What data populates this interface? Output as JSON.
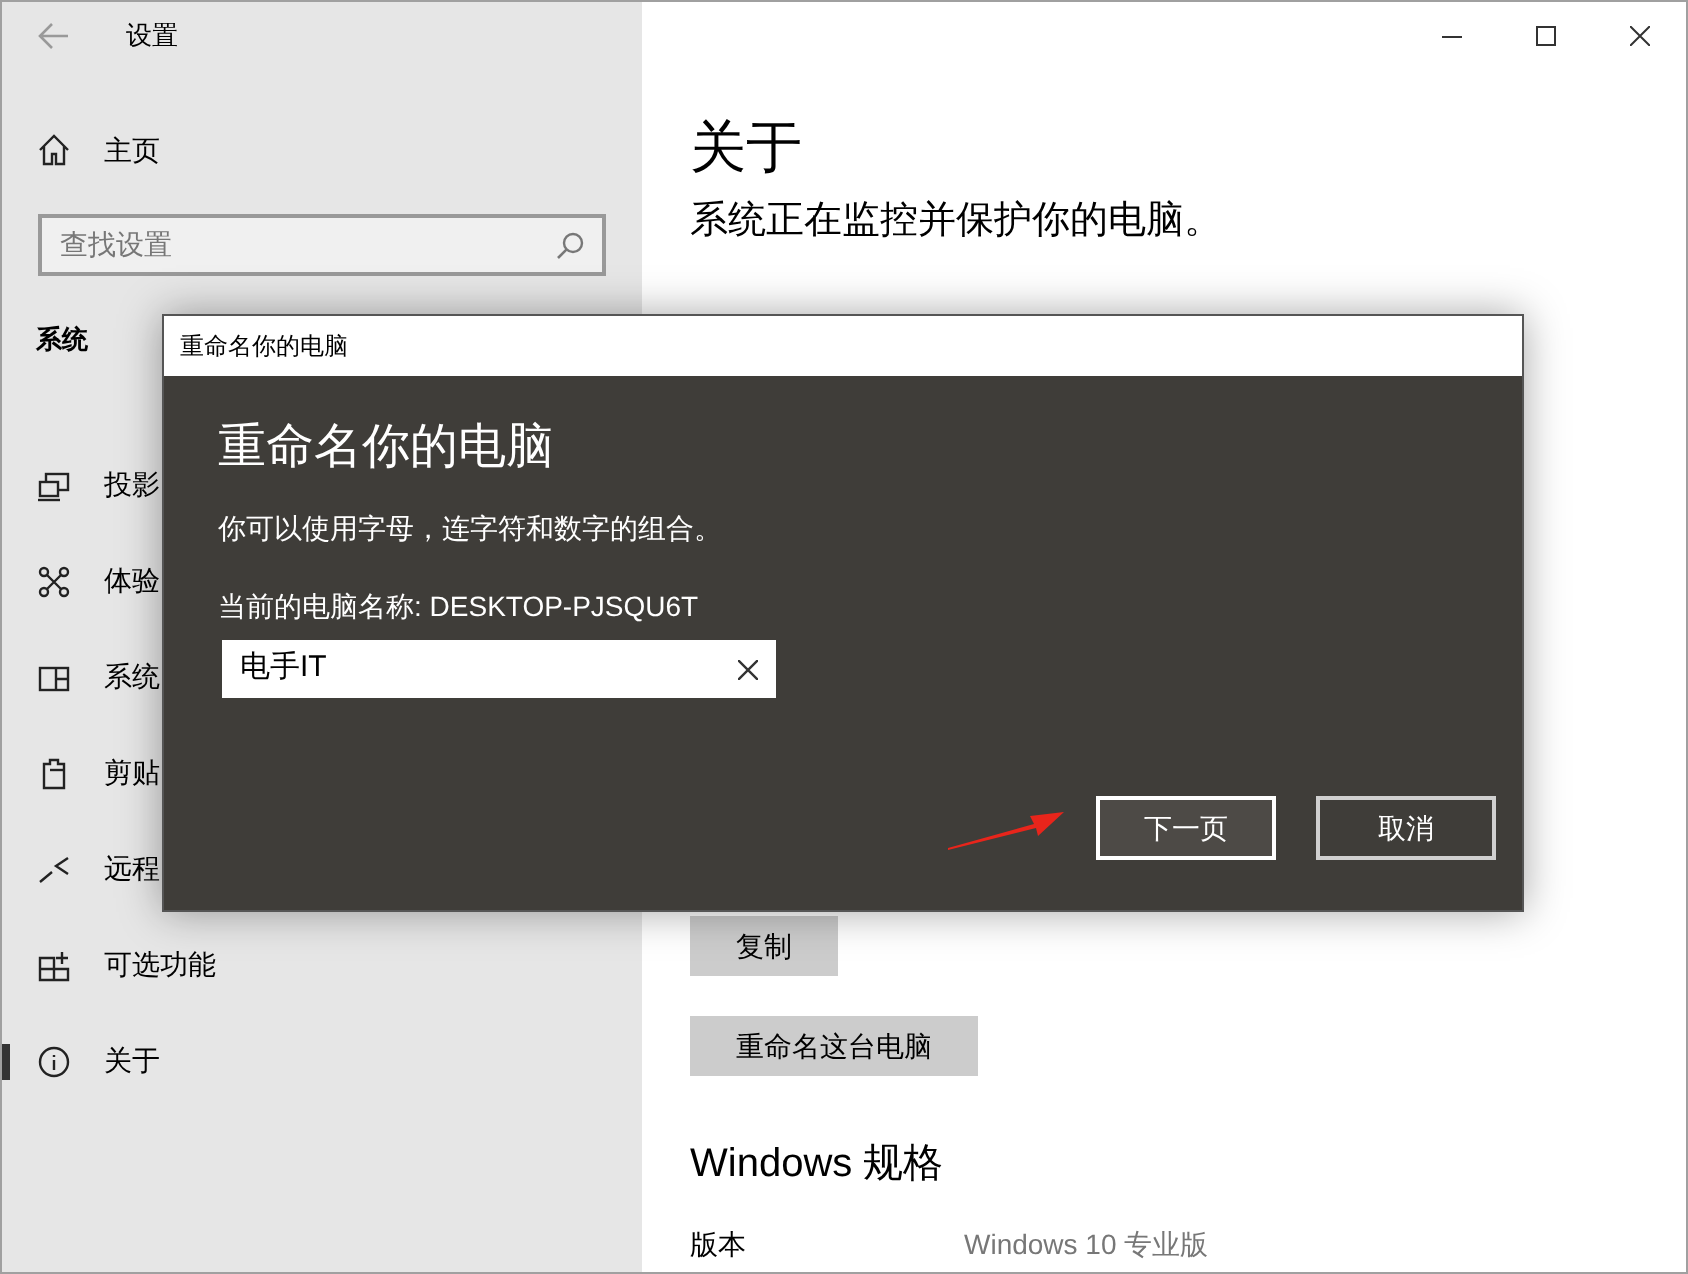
{
  "window": {
    "title": "设置"
  },
  "sidebar": {
    "home": "主页",
    "search": {
      "placeholder": "查找设置"
    },
    "section": "系统",
    "items": [
      {
        "label": "投影",
        "selected": false
      },
      {
        "label": "体验",
        "selected": false
      },
      {
        "label": "系统",
        "selected": false
      },
      {
        "label": "剪贴",
        "selected": false
      },
      {
        "label": "远程",
        "selected": false
      },
      {
        "label": "可选功能",
        "selected": false
      },
      {
        "label": "关于",
        "selected": true
      }
    ]
  },
  "content": {
    "title": "关于",
    "subtitle": "系统正在监控并保护你的电脑。",
    "buttons": [
      "复制",
      "重命名这台电脑"
    ],
    "spec_heading": "Windows 规格",
    "spec_rows": [
      {
        "label": "版本",
        "value": "Windows 10 专业版"
      }
    ]
  },
  "dialog": {
    "title": "重命名你的电脑",
    "heading": "重命名你的电脑",
    "description": "你可以使用字母，连字符和数字的组合。",
    "current_name": "当前的电脑名称: DESKTOP-PJSQU6T",
    "input": {
      "value": "电手IT"
    },
    "buttons": [
      {
        "label": "下一页",
        "selected": true
      },
      {
        "label": "取消",
        "selected": false
      }
    ]
  }
}
